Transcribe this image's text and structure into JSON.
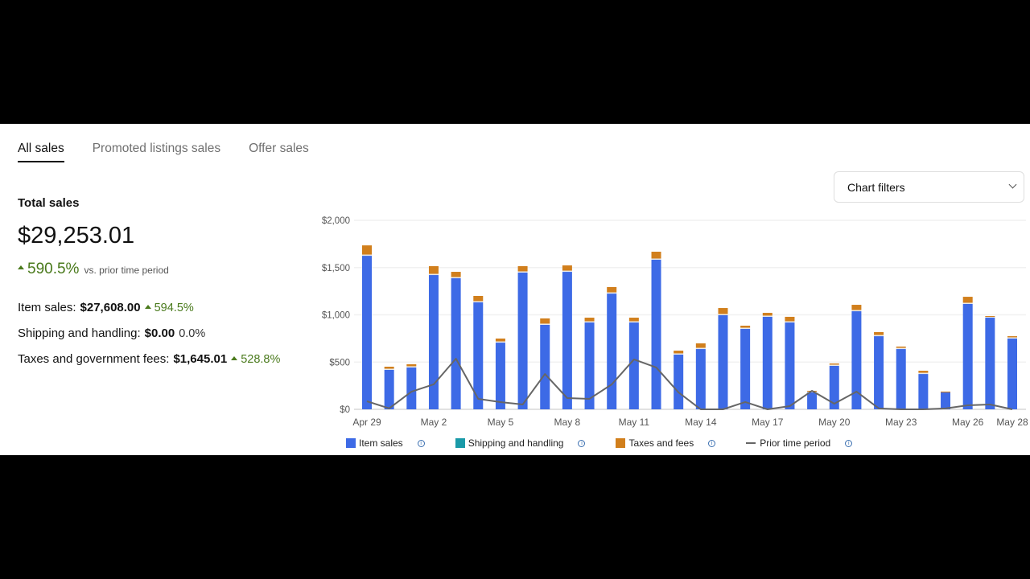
{
  "tabs": [
    {
      "label": "All sales",
      "active": true
    },
    {
      "label": "Promoted listings sales",
      "active": false
    },
    {
      "label": "Offer sales",
      "active": false
    }
  ],
  "summary": {
    "title": "Total sales",
    "total": "$29,253.01",
    "change_pct": "590.5%",
    "change_label": "vs. prior time period",
    "rows": [
      {
        "label": "Item sales:",
        "value": "$27,608.00",
        "change": "594.5%",
        "trend": "up"
      },
      {
        "label": "Shipping and handling:",
        "value": "$0.00",
        "change": "0.0%",
        "trend": "flat"
      },
      {
        "label": "Taxes and government fees:",
        "value": "$1,645.01",
        "change": "528.8%",
        "trend": "up"
      }
    ]
  },
  "filter": {
    "label": "Chart filters",
    "icon": "chevron-down-icon"
  },
  "legend": [
    {
      "label": "Item sales",
      "color": "#3d6ae6",
      "kind": "box"
    },
    {
      "label": "Shipping and handling",
      "color": "#1a9aa8",
      "kind": "box"
    },
    {
      "label": "Taxes and fees",
      "color": "#d17f1c",
      "kind": "box"
    },
    {
      "label": "Prior time period",
      "color": "#666666",
      "kind": "line"
    }
  ],
  "chart_data": {
    "type": "bar",
    "stacked": true,
    "title": "",
    "xlabel": "",
    "ylabel": "",
    "ylim": [
      0,
      2000
    ],
    "yticks": [
      "$0",
      "$500",
      "$1,000",
      "$1,500",
      "$2,000"
    ],
    "ytick_values": [
      0,
      500,
      1000,
      1500,
      2000
    ],
    "grid": true,
    "legend_position": "bottom",
    "categories": [
      "Apr 29",
      "Apr 30",
      "May 1",
      "May 2",
      "May 3",
      "May 4",
      "May 5",
      "May 6",
      "May 7",
      "May 8",
      "May 9",
      "May 10",
      "May 11",
      "May 12",
      "May 13",
      "May 14",
      "May 15",
      "May 16",
      "May 17",
      "May 18",
      "May 19",
      "May 20",
      "May 21",
      "May 22",
      "May 23",
      "May 24",
      "May 25",
      "May 26",
      "May 27",
      "May 28"
    ],
    "xtick_labels": [
      {
        "index": 0,
        "label": "Apr 29"
      },
      {
        "index": 3,
        "label": "May 2"
      },
      {
        "index": 6,
        "label": "May 5"
      },
      {
        "index": 9,
        "label": "May 8"
      },
      {
        "index": 12,
        "label": "May 11"
      },
      {
        "index": 15,
        "label": "May 14"
      },
      {
        "index": 18,
        "label": "May 17"
      },
      {
        "index": 21,
        "label": "May 20"
      },
      {
        "index": 24,
        "label": "May 23"
      },
      {
        "index": 27,
        "label": "May 26"
      },
      {
        "index": 29,
        "label": "May 28"
      }
    ],
    "series": [
      {
        "name": "Item sales",
        "type": "bar",
        "color": "#3d6ae6",
        "values": [
          1625,
          417,
          443,
          1421,
          1387,
          1132,
          706,
          1447,
          894,
          1455,
          919,
          1225,
          919,
          1583,
          579,
          638,
          996,
          851,
          979,
          919,
          179,
          460,
          1038,
          774,
          638,
          374,
          179,
          1115,
          970,
          749
        ]
      },
      {
        "name": "Shipping and handling",
        "type": "bar",
        "color": "#1a9aa8",
        "values": [
          0,
          0,
          0,
          0,
          0,
          0,
          0,
          0,
          0,
          0,
          0,
          0,
          0,
          0,
          0,
          0,
          0,
          0,
          0,
          0,
          0,
          0,
          0,
          0,
          0,
          0,
          0,
          0,
          0,
          0
        ]
      },
      {
        "name": "Taxes and fees",
        "type": "bar",
        "color": "#d17f1c",
        "values": [
          110,
          34,
          34,
          94,
          68,
          68,
          43,
          68,
          68,
          68,
          51,
          69,
          51,
          85,
          42,
          60,
          76,
          34,
          42,
          60,
          17,
          25,
          68,
          43,
          26,
          34,
          8,
          76,
          17,
          25
        ]
      },
      {
        "name": "Prior time period",
        "type": "line",
        "color": "#666666",
        "values": [
          85,
          10,
          187,
          264,
          536,
          111,
          77,
          51,
          374,
          119,
          111,
          264,
          528,
          443,
          179,
          0,
          0,
          77,
          0,
          34,
          196,
          60,
          187,
          10,
          0,
          0,
          10,
          43,
          51,
          0
        ]
      }
    ]
  }
}
